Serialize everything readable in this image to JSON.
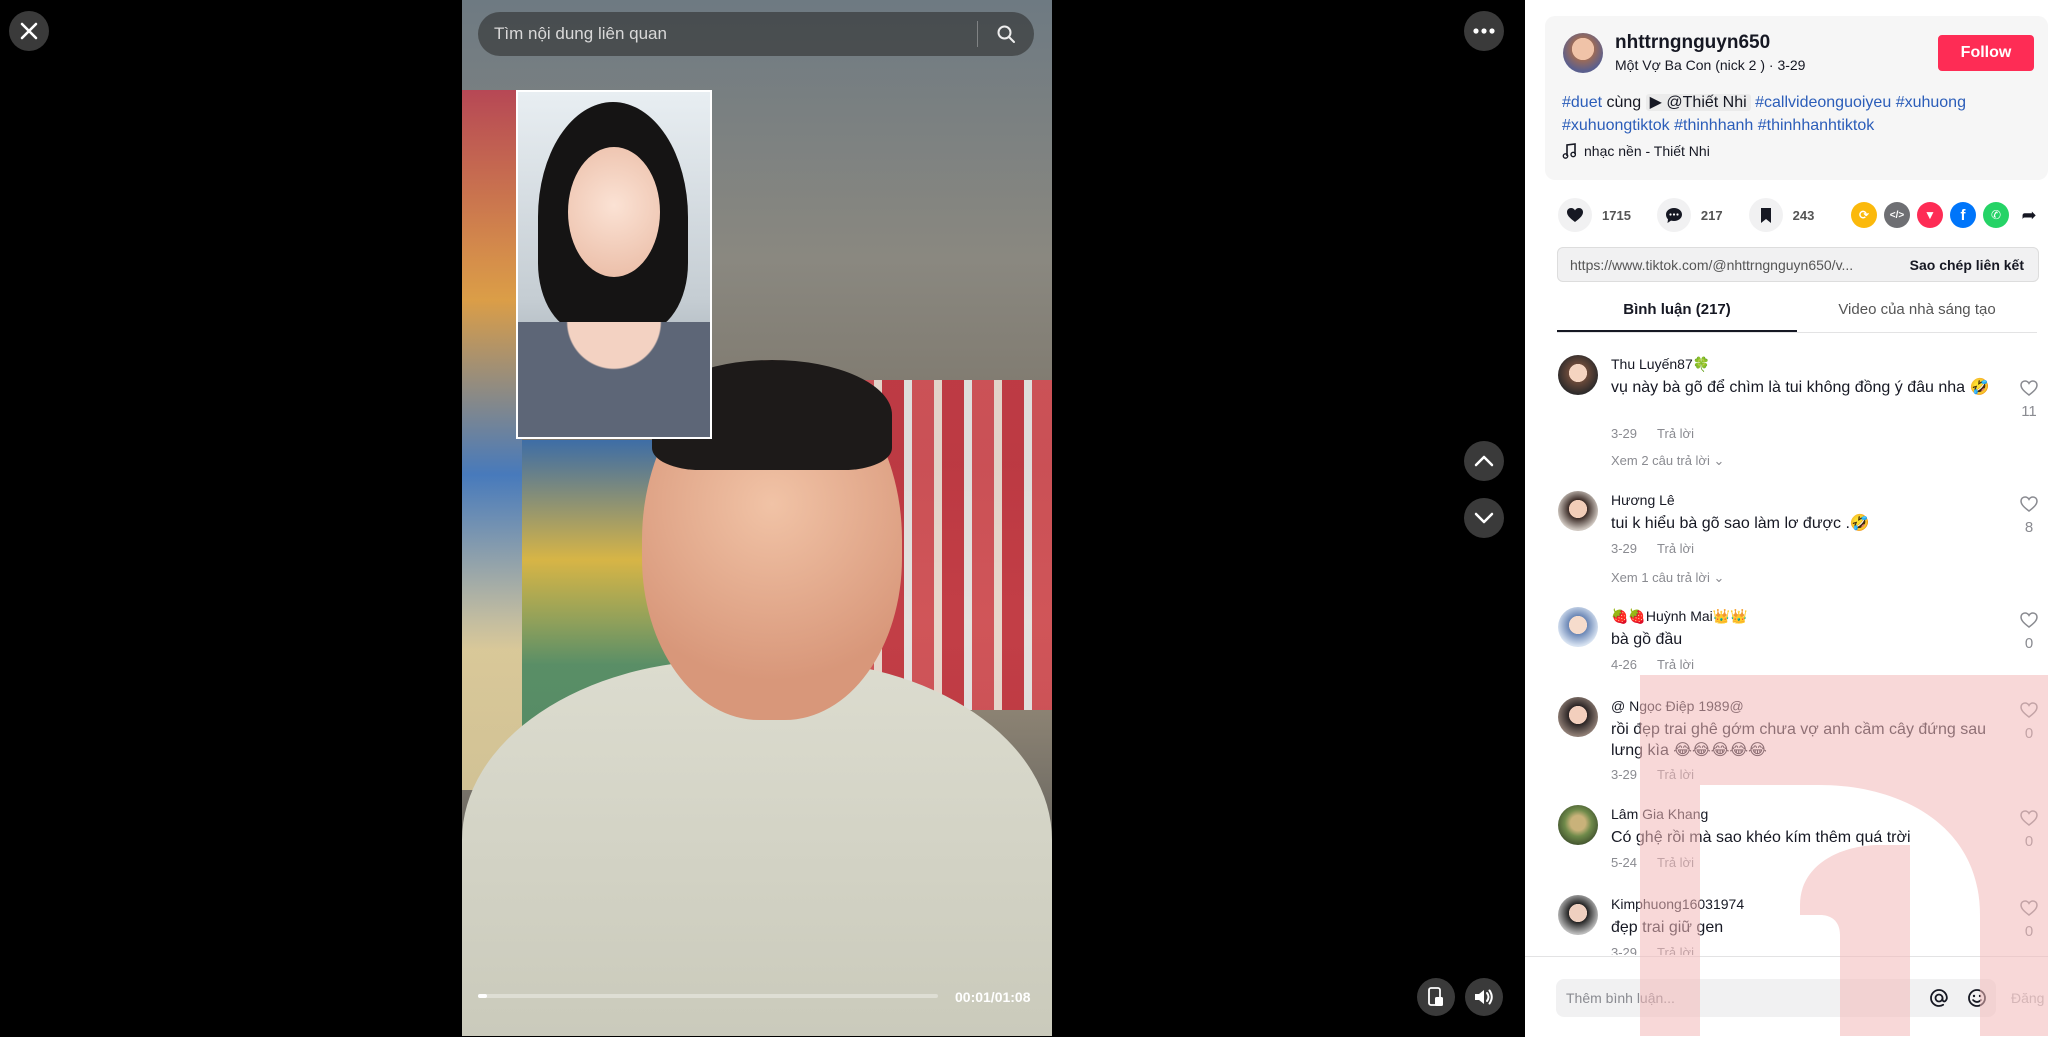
{
  "search": {
    "placeholder": "Tìm nội dung liên quan"
  },
  "player": {
    "time": "00:01/01:08",
    "progress_fraction": 0.02
  },
  "author": {
    "name": "nhttrngnguyn650",
    "subtitle": "Một Vợ Ba Con (nick 2 ) · 3-29",
    "follow_label": "Follow"
  },
  "description": {
    "tag_duet": "#duet",
    "word_cung": "cùng",
    "mention": "@Thiết Nhi",
    "tag1": "#callvideonguoiyeu",
    "tag2": "#xuhuong",
    "tag3": "#xuhuongtiktok",
    "tag4": "#thinhhanh",
    "tag5": "#thinhhanhtiktok",
    "music": "nhạc nền - Thiết Nhi"
  },
  "stats": {
    "likes": "1715",
    "comments": "217",
    "saves": "243"
  },
  "share": {
    "url": "https://www.tiktok.com/@nhttrngnguyn650/v...",
    "copy_label": "Sao chép liên kết"
  },
  "tabs": {
    "comments": "Bình luận (217)",
    "creator_videos": "Video của nhà sáng tạo"
  },
  "reply_label": "Trả lời",
  "comments": [
    {
      "name": "Thu Luyến87🍀",
      "text": "vụ này bà gõ để chìm là tui không đồng ý đâu nha 🤣",
      "date": "3-29",
      "replies": "Xem 2 câu trả lời",
      "likes": "11"
    },
    {
      "name": "Hương Lê",
      "text": "tui k hiểu bà gõ sao làm lơ được .🤣",
      "date": "3-29",
      "replies": "Xem 1 câu trả lời",
      "likes": "8"
    },
    {
      "name": "🍓🍓Huỳnh Mai👑👑",
      "text": "bà gồ đầu",
      "date": "4-26",
      "replies": "",
      "likes": "0"
    },
    {
      "name": "@ Ngọc Điệp 1989@",
      "text": "rồi đẹp trai ghê gớm chưa vợ anh cầm cây đứng sau lưng kìa 😂😂😂😂😂",
      "date": "3-29",
      "replies": "",
      "likes": "0"
    },
    {
      "name": "Lâm Gia Khang",
      "text": "Có ghệ rồi mà sao khéo kím thêm quá trời",
      "date": "5-24",
      "replies": "",
      "likes": "0"
    },
    {
      "name": "Kimphuong16031974",
      "text": "đẹp trai giữ gen",
      "date": "3-29",
      "replies": "",
      "likes": "0"
    }
  ],
  "composer": {
    "placeholder": "Thêm bình luận...",
    "post_label": "Đăng"
  },
  "colors": {
    "accent": "#fe2c55",
    "hashtag": "#2b5db9"
  },
  "icons": [
    "close-icon",
    "search-icon",
    "more-icon",
    "chevron-up-icon",
    "chevron-down-icon",
    "pip-icon",
    "volume-icon",
    "heart-icon",
    "comment-icon",
    "bookmark-icon",
    "music-note-icon",
    "at-icon",
    "emoji-icon"
  ]
}
